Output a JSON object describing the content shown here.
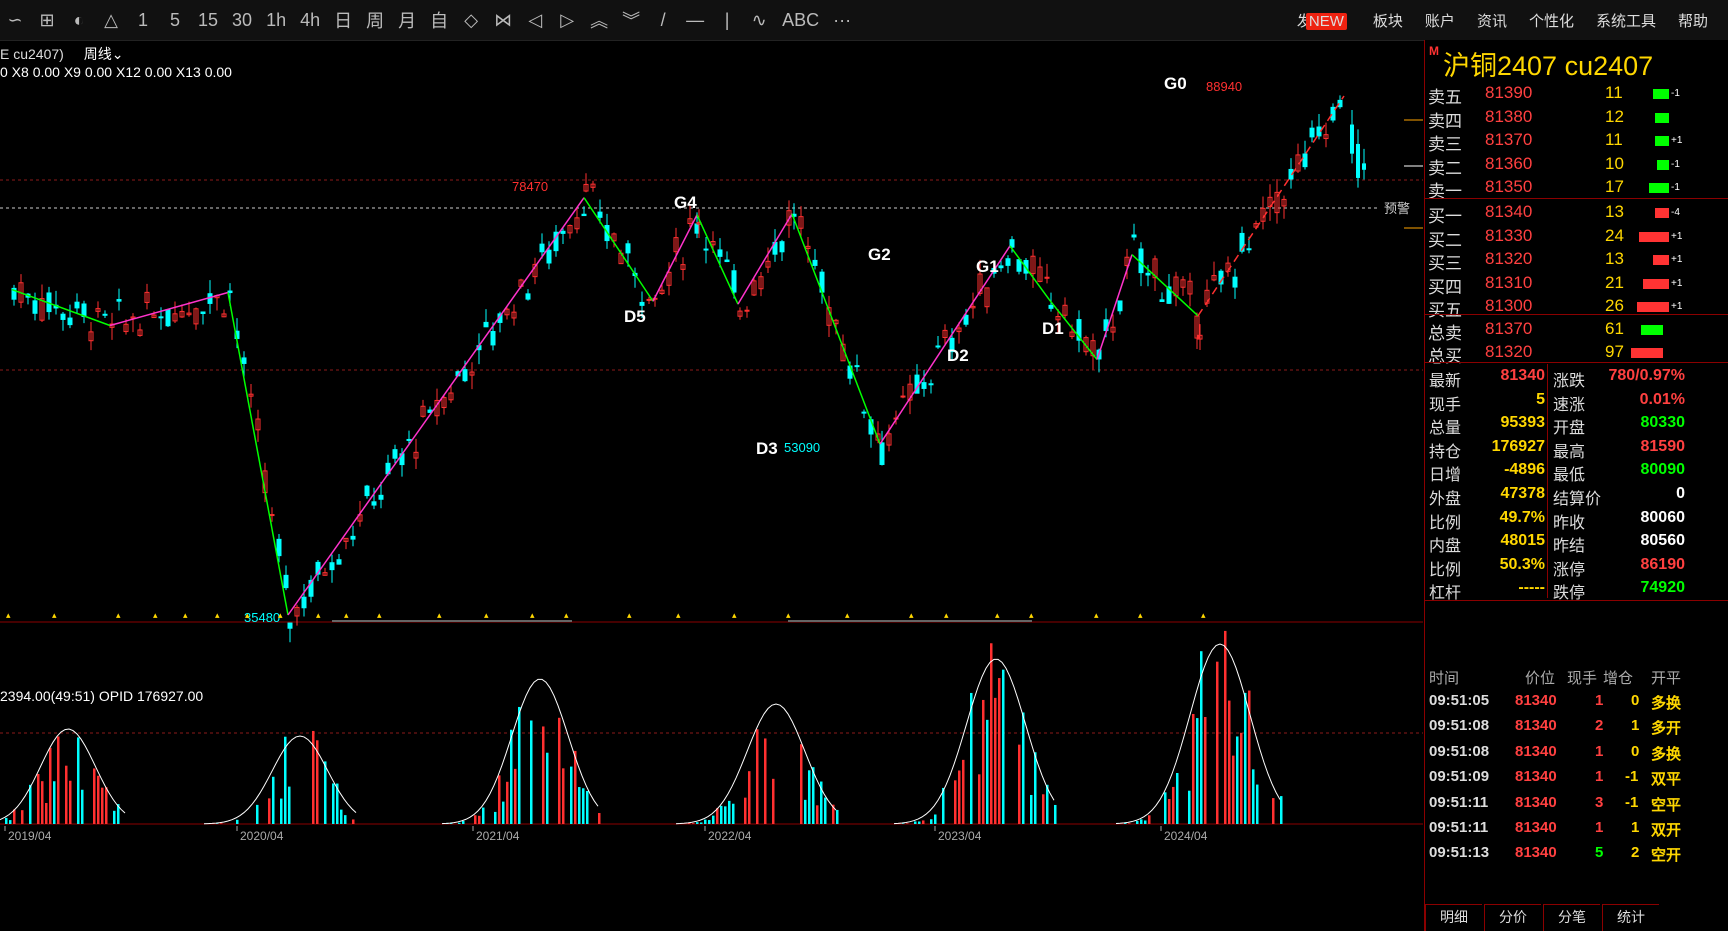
{
  "toolbar": {
    "left_items": [
      "∽",
      "⊞",
      "◐",
      "△",
      "1",
      "5",
      "15",
      "30",
      "1h",
      "4h",
      "日",
      "周",
      "月",
      "自",
      "◇",
      "⋈",
      "◁",
      "▷",
      "︽",
      "︾",
      "/",
      "—",
      "|",
      "∿",
      "ABC",
      "···"
    ],
    "right_items": [
      "发现",
      "板块",
      "账户",
      "资讯",
      "个性化",
      "系统工具",
      "帮助"
    ],
    "new_badge": "NEW"
  },
  "chart_header": {
    "symbol": "E cu2407)",
    "period": "周线"
  },
  "indicator": "0  X8 0.00  X9 0.00  X12 0.00  X13 0.00",
  "volume_header": "2394.00(49:51)  OPID 176927.00",
  "annotations": {
    "g0": "G0",
    "g4": "G4",
    "g2": "G2",
    "g1": "G1",
    "d5": "D5",
    "d2": "D2",
    "d1": "D1",
    "d3": "D3",
    "p_88940": "88940",
    "p_78470": "78470",
    "p_53090": "53090",
    "p_35480": "35480",
    "alert": "预警"
  },
  "x_axis_labels": [
    "2019/04",
    "2020/04",
    "2021/04",
    "2022/04",
    "2023/04",
    "2024/04"
  ],
  "chart_data": {
    "type": "candlestick",
    "title": "沪铜2407 cu2407 周线",
    "x_ticks": [
      "2019/04",
      "2020/04",
      "2021/04",
      "2022/04",
      "2023/04",
      "2024/04"
    ],
    "marked_prices": {
      "high_2024": 88940,
      "high_2021": 78470,
      "low_2022": 53090,
      "low_2020": 35480
    },
    "zigzag_points": [
      {
        "label": "G4",
        "value": 78470
      },
      {
        "label": "D5",
        "value": null
      },
      {
        "label": "D3",
        "value": 53090
      },
      {
        "label": "G2",
        "value": null
      },
      {
        "label": "D2",
        "value": null
      },
      {
        "label": "G1",
        "value": null
      },
      {
        "label": "D1",
        "value": null
      },
      {
        "label": "G0",
        "value": 88940
      }
    ],
    "last_price": 81340
  },
  "panel": {
    "m": "M",
    "title": "沪铜2407  cu2407",
    "asks": [
      {
        "label": "卖五",
        "price": "81390",
        "qty": "11",
        "chg": "-1",
        "bar": 16
      },
      {
        "label": "卖四",
        "price": "81380",
        "qty": "12",
        "chg": "",
        "bar": 14
      },
      {
        "label": "卖三",
        "price": "81370",
        "qty": "11",
        "chg": "+1",
        "bar": 14
      },
      {
        "label": "卖二",
        "price": "81360",
        "qty": "10",
        "chg": "-1",
        "bar": 12
      },
      {
        "label": "卖一",
        "price": "81350",
        "qty": "17",
        "chg": "-1",
        "bar": 20
      }
    ],
    "bids": [
      {
        "label": "买一",
        "price": "81340",
        "qty": "13",
        "chg": "-4",
        "bar": 14
      },
      {
        "label": "买二",
        "price": "81330",
        "qty": "24",
        "chg": "+1",
        "bar": 30
      },
      {
        "label": "买三",
        "price": "81320",
        "qty": "13",
        "chg": "+1",
        "bar": 16
      },
      {
        "label": "买四",
        "price": "81310",
        "qty": "21",
        "chg": "+1",
        "bar": 26
      },
      {
        "label": "买五",
        "price": "81300",
        "qty": "26",
        "chg": "+1",
        "bar": 32
      }
    ],
    "totals": [
      {
        "label": "总卖",
        "price": "81370",
        "qty": "61",
        "color": "#0f0"
      },
      {
        "label": "总买",
        "price": "81320",
        "qty": "97",
        "color": "#f33"
      }
    ],
    "quotes_left": [
      {
        "label": "最新",
        "value": "81340",
        "color": "#ff4040"
      },
      {
        "label": "现手",
        "value": "5",
        "color": "#ffd700"
      },
      {
        "label": "总量",
        "value": "95393",
        "color": "#ffd700"
      },
      {
        "label": "持仓",
        "value": "176927",
        "color": "#ffd700"
      },
      {
        "label": "日增",
        "value": "-4896",
        "color": "#ffd700"
      },
      {
        "label": "外盘",
        "value": "47378",
        "color": "#ffd700"
      },
      {
        "label": "比例",
        "value": "49.7%",
        "color": "#ffd700"
      },
      {
        "label": "内盘",
        "value": "48015",
        "color": "#ffd700"
      },
      {
        "label": "比例",
        "value": "50.3%",
        "color": "#ffd700"
      },
      {
        "label": "杠杆",
        "value": "-----",
        "color": "#ffd700"
      }
    ],
    "quotes_right": [
      {
        "label": "涨跌",
        "value": "780/0.97%",
        "color": "#ff4040"
      },
      {
        "label": "速涨",
        "value": "0.01%",
        "color": "#ff4040"
      },
      {
        "label": "开盘",
        "value": "80330",
        "color": "#0f0"
      },
      {
        "label": "最高",
        "value": "81590",
        "color": "#ff4040"
      },
      {
        "label": "最低",
        "value": "80090",
        "color": "#0f0"
      },
      {
        "label": "结算价",
        "value": "0",
        "color": "#fff"
      },
      {
        "label": "昨收",
        "value": "80060",
        "color": "#fff"
      },
      {
        "label": "昨结",
        "value": "80560",
        "color": "#fff"
      },
      {
        "label": "涨停",
        "value": "86190",
        "color": "#ff4040"
      },
      {
        "label": "跌停",
        "value": "74920",
        "color": "#0f0"
      }
    ],
    "ticks_header": [
      "时间",
      "价位",
      "现手",
      "增仓",
      "开平"
    ],
    "ticks": [
      {
        "time": "09:51:05",
        "price": "81340",
        "vol": "1",
        "oi": "0",
        "type": "多换",
        "vc": "#ff4040",
        "tc": "#ffd700"
      },
      {
        "time": "09:51:08",
        "price": "81340",
        "vol": "2",
        "oi": "1",
        "type": "多开",
        "vc": "#ff4040",
        "tc": "#ffd700"
      },
      {
        "time": "09:51:08",
        "price": "81340",
        "vol": "1",
        "oi": "0",
        "type": "多换",
        "vc": "#ff4040",
        "tc": "#ffd700"
      },
      {
        "time": "09:51:09",
        "price": "81340",
        "vol": "1",
        "oi": "-1",
        "type": "双平",
        "vc": "#ff4040",
        "tc": "#ffd700"
      },
      {
        "time": "09:51:11",
        "price": "81340",
        "vol": "3",
        "oi": "-1",
        "type": "空平",
        "vc": "#ff4040",
        "tc": "#ffd700"
      },
      {
        "time": "09:51:11",
        "price": "81340",
        "vol": "1",
        "oi": "1",
        "type": "双开",
        "vc": "#ff4040",
        "tc": "#ffd700"
      },
      {
        "time": "09:51:13",
        "price": "81340",
        "vol": "5",
        "oi": "2",
        "type": "空开",
        "vc": "#0f0",
        "tc": "#ffd700"
      }
    ],
    "bottom_tabs": [
      "明细",
      "分价",
      "分笔",
      "统计"
    ]
  }
}
